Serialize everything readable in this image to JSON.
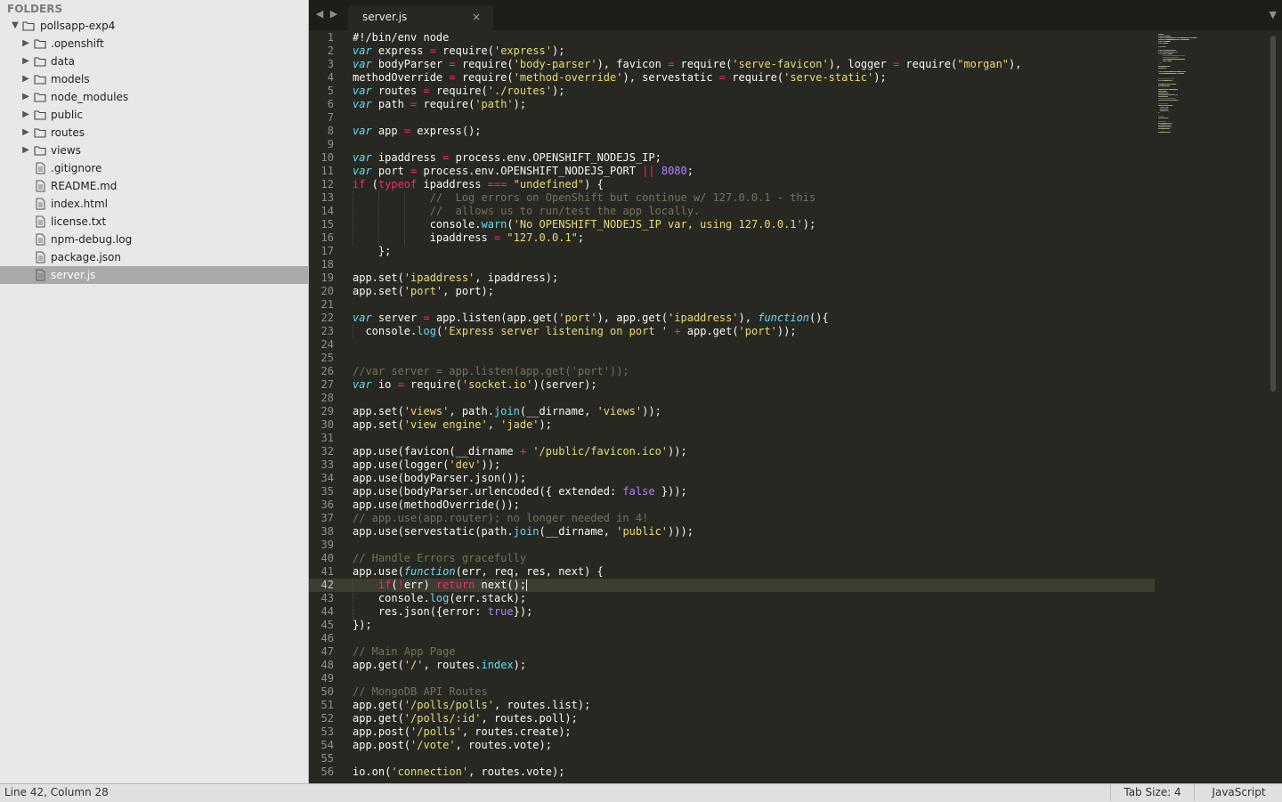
{
  "sidebar": {
    "header": "FOLDERS",
    "root": {
      "name": "pollsapp-exp4"
    },
    "folders": [
      ".openshift",
      "data",
      "models",
      "node_modules",
      "public",
      "routes",
      "views"
    ],
    "files": [
      ".gitignore",
      "README.md",
      "index.html",
      "license.txt",
      "npm-debug.log",
      "package.json",
      "server.js"
    ],
    "selected_file": "server.js"
  },
  "tabs": {
    "active": {
      "title": "server.js",
      "close": "×"
    }
  },
  "icons": {
    "back": "chevron-left-icon",
    "forward": "chevron-right-icon",
    "tabs_menu": "chevron-down-icon",
    "folder": "folder-icon",
    "file": "file-icon",
    "expand": "triangle-right-icon",
    "collapse": "triangle-down-icon"
  },
  "colors": {
    "editor_bg": "#272822",
    "keyword": "#66d9ef",
    "operator": "#f92672",
    "string": "#e6db74",
    "number": "#ae81ff",
    "comment": "#75715e",
    "sidebar_bg": "#e8e8e8",
    "selected_row": "#a9a9a9"
  },
  "editor": {
    "current_line": 42,
    "lines": [
      [
        [
          "#!/bin/env node",
          ""
        ]
      ],
      [
        [
          "var",
          "k"
        ],
        [
          " express ",
          ""
        ],
        [
          "=",
          "r"
        ],
        [
          " require(",
          ""
        ],
        [
          "'express'",
          "s"
        ],
        [
          ");",
          ""
        ]
      ],
      [
        [
          "var",
          "k"
        ],
        [
          " bodyParser ",
          ""
        ],
        [
          "=",
          "r"
        ],
        [
          " require(",
          ""
        ],
        [
          "'body-parser'",
          "s"
        ],
        [
          "), favicon ",
          ""
        ],
        [
          "=",
          "r"
        ],
        [
          " require(",
          ""
        ],
        [
          "'serve-favicon'",
          "s"
        ],
        [
          "), logger ",
          ""
        ],
        [
          "=",
          "r"
        ],
        [
          " require(",
          ""
        ],
        [
          "\"morgan\"",
          "s"
        ],
        [
          "),",
          ""
        ]
      ],
      [
        [
          "methodOverride ",
          ""
        ],
        [
          "=",
          "r"
        ],
        [
          " require(",
          ""
        ],
        [
          "'method-override'",
          "s"
        ],
        [
          "), servestatic ",
          ""
        ],
        [
          "=",
          "r"
        ],
        [
          " require(",
          ""
        ],
        [
          "'serve-static'",
          "s"
        ],
        [
          ");",
          ""
        ]
      ],
      [
        [
          "var",
          "k"
        ],
        [
          " routes ",
          ""
        ],
        [
          "=",
          "r"
        ],
        [
          " require(",
          ""
        ],
        [
          "'./routes'",
          "s"
        ],
        [
          ");",
          ""
        ]
      ],
      [
        [
          "var",
          "k"
        ],
        [
          " path ",
          ""
        ],
        [
          "=",
          "r"
        ],
        [
          " require(",
          ""
        ],
        [
          "'path'",
          "s"
        ],
        [
          ");",
          ""
        ]
      ],
      [],
      [
        [
          "var",
          "k"
        ],
        [
          " app ",
          ""
        ],
        [
          "=",
          "r"
        ],
        [
          " express();",
          ""
        ]
      ],
      [],
      [
        [
          "var",
          "k"
        ],
        [
          " ipaddress ",
          ""
        ],
        [
          "=",
          "r"
        ],
        [
          " process.env.OPENSHIFT_NODEJS_IP;",
          ""
        ]
      ],
      [
        [
          "var",
          "k"
        ],
        [
          " port ",
          ""
        ],
        [
          "=",
          "r"
        ],
        [
          " process.env.OPENSHIFT_NODEJS_PORT ",
          ""
        ],
        [
          "||",
          "r"
        ],
        [
          " ",
          ""
        ],
        [
          "8080",
          "n"
        ],
        [
          ";",
          ""
        ]
      ],
      [
        [
          "if",
          "r"
        ],
        [
          " (",
          ""
        ],
        [
          "typeof",
          "r"
        ],
        [
          " ipaddress ",
          ""
        ],
        [
          "===",
          "r"
        ],
        [
          " ",
          ""
        ],
        [
          "\"undefined\"",
          "s"
        ],
        [
          ") {",
          ""
        ]
      ],
      [
        [
          "            ",
          ""
        ],
        [
          "//  Log errors on OpenShift but continue w/ 127.0.0.1 - this",
          "c"
        ]
      ],
      [
        [
          "            ",
          ""
        ],
        [
          "//  allows us to run/test the app locally.",
          "c"
        ]
      ],
      [
        [
          "            console.",
          ""
        ],
        [
          "warn",
          "f"
        ],
        [
          "(",
          ""
        ],
        [
          "'No OPENSHIFT_NODEJS_IP var, using 127.0.0.1'",
          "s"
        ],
        [
          ");",
          ""
        ]
      ],
      [
        [
          "            ipaddress ",
          ""
        ],
        [
          "=",
          "r"
        ],
        [
          " ",
          ""
        ],
        [
          "\"127.0.0.1\"",
          "s"
        ],
        [
          ";",
          ""
        ]
      ],
      [
        [
          "    };",
          ""
        ]
      ],
      [],
      [
        [
          "app.set(",
          ""
        ],
        [
          "'ipaddress'",
          "s"
        ],
        [
          ", ipaddress);",
          ""
        ]
      ],
      [
        [
          "app.set(",
          ""
        ],
        [
          "'port'",
          "s"
        ],
        [
          ", port);",
          ""
        ]
      ],
      [],
      [
        [
          "var",
          "k"
        ],
        [
          " server ",
          ""
        ],
        [
          "=",
          "r"
        ],
        [
          " app.listen(app.get(",
          ""
        ],
        [
          "'port'",
          "s"
        ],
        [
          "), app.get(",
          ""
        ],
        [
          "'ipaddress'",
          "s"
        ],
        [
          "), ",
          ""
        ],
        [
          "function",
          "k"
        ],
        [
          "(){",
          ""
        ]
      ],
      [
        [
          "  console.",
          ""
        ],
        [
          "log",
          "f"
        ],
        [
          "(",
          ""
        ],
        [
          "'Express server listening on port '",
          "s"
        ],
        [
          " ",
          ""
        ],
        [
          "+",
          "r"
        ],
        [
          " app.get(",
          ""
        ],
        [
          "'port'",
          "s"
        ],
        [
          "));",
          ""
        ]
      ],
      [],
      [],
      [
        [
          "//var server = app.listen(app.get('port'));",
          "c"
        ]
      ],
      [
        [
          "var",
          "k"
        ],
        [
          " io ",
          ""
        ],
        [
          "=",
          "r"
        ],
        [
          " require(",
          ""
        ],
        [
          "'socket.io'",
          "s"
        ],
        [
          ")(server);",
          ""
        ]
      ],
      [],
      [
        [
          "app.set(",
          ""
        ],
        [
          "'views'",
          "s"
        ],
        [
          ", path.",
          ""
        ],
        [
          "join",
          "f"
        ],
        [
          "(__dirname, ",
          ""
        ],
        [
          "'views'",
          "s"
        ],
        [
          "));",
          ""
        ]
      ],
      [
        [
          "app.set(",
          ""
        ],
        [
          "'view engine'",
          "s"
        ],
        [
          ", ",
          ""
        ],
        [
          "'jade'",
          "s"
        ],
        [
          ");",
          ""
        ]
      ],
      [],
      [
        [
          "app.use(favicon(__dirname ",
          ""
        ],
        [
          "+",
          "r"
        ],
        [
          " ",
          ""
        ],
        [
          "'/public/favicon.ico'",
          "s"
        ],
        [
          "));",
          ""
        ]
      ],
      [
        [
          "app.use(logger(",
          ""
        ],
        [
          "'dev'",
          "s"
        ],
        [
          "));",
          ""
        ]
      ],
      [
        [
          "app.use(bodyParser.json());",
          ""
        ]
      ],
      [
        [
          "app.use(bodyParser.urlencoded({ extended: ",
          ""
        ],
        [
          "false",
          "n"
        ],
        [
          " }));",
          ""
        ]
      ],
      [
        [
          "app.use(methodOverride());",
          ""
        ]
      ],
      [
        [
          "// app.use(app.router); no longer needed in 4!",
          "c"
        ]
      ],
      [
        [
          "app.use(servestatic(path.",
          ""
        ],
        [
          "join",
          "f"
        ],
        [
          "(__dirname, ",
          ""
        ],
        [
          "'public'",
          "s"
        ],
        [
          ")));",
          ""
        ]
      ],
      [],
      [
        [
          "// Handle Errors gracefully",
          "c"
        ]
      ],
      [
        [
          "app.use(",
          ""
        ],
        [
          "function",
          "k"
        ],
        [
          "(err, req, res, next) {",
          ""
        ]
      ],
      [
        [
          "    ",
          ""
        ],
        [
          "if",
          "r"
        ],
        [
          "(",
          ""
        ],
        [
          "!",
          "r"
        ],
        [
          "err) ",
          ""
        ],
        [
          "return",
          "r"
        ],
        [
          " next();",
          ""
        ],
        [
          "|",
          "cursor"
        ]
      ],
      [
        [
          "    console.",
          ""
        ],
        [
          "log",
          "f"
        ],
        [
          "(err.stack);",
          ""
        ]
      ],
      [
        [
          "    res.json({error: ",
          ""
        ],
        [
          "true",
          "n"
        ],
        [
          "});",
          ""
        ]
      ],
      [
        [
          "});",
          ""
        ]
      ],
      [],
      [
        [
          "// Main App Page",
          "c"
        ]
      ],
      [
        [
          "app.get(",
          ""
        ],
        [
          "'/'",
          "s"
        ],
        [
          ", routes.",
          ""
        ],
        [
          "index",
          "f"
        ],
        [
          ");",
          ""
        ]
      ],
      [],
      [
        [
          "// MongoDB API Routes",
          "c"
        ]
      ],
      [
        [
          "app.get(",
          ""
        ],
        [
          "'/polls/polls'",
          "s"
        ],
        [
          ", routes.list);",
          ""
        ]
      ],
      [
        [
          "app.get(",
          ""
        ],
        [
          "'/polls/:id'",
          "s"
        ],
        [
          ", routes.poll);",
          ""
        ]
      ],
      [
        [
          "app.post(",
          ""
        ],
        [
          "'/polls'",
          "s"
        ],
        [
          ", routes.create);",
          ""
        ]
      ],
      [
        [
          "app.post(",
          ""
        ],
        [
          "'/vote'",
          "s"
        ],
        [
          ", routes.vote);",
          ""
        ]
      ],
      [],
      [
        [
          "io.on(",
          ""
        ],
        [
          "'connection'",
          "s"
        ],
        [
          ", routes.vote);",
          ""
        ]
      ]
    ]
  },
  "status": {
    "position": "Line 42, Column 28",
    "tab_size": "Tab Size: 4",
    "syntax": "JavaScript"
  }
}
